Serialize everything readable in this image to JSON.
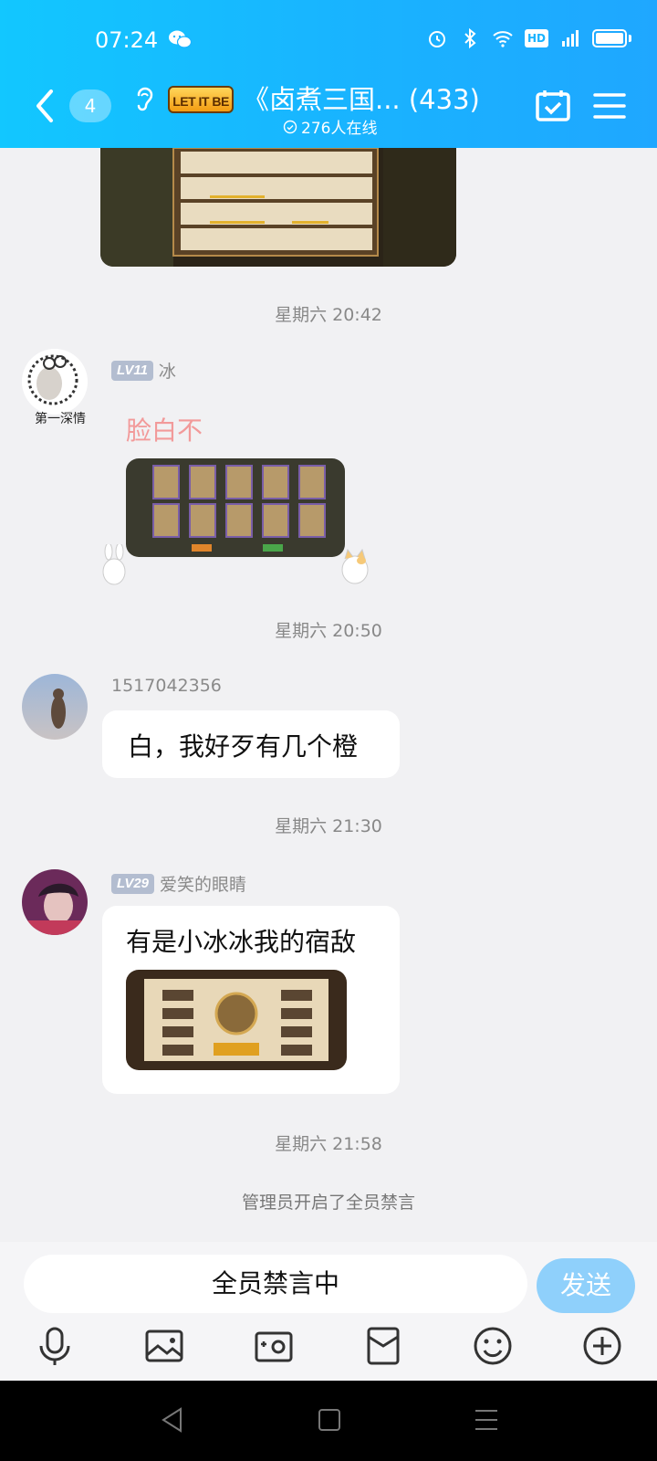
{
  "status_bar": {
    "time": "07:24",
    "hd": "HD",
    "network": "4G"
  },
  "header": {
    "unread_count": "4",
    "logo_text": "LET IT BE",
    "title": "《卤煮三国...  (433)",
    "online": "276人在线"
  },
  "messages": {
    "ts1": "星期六 20:42",
    "m1": {
      "level": "LV11",
      "name": "冰",
      "text": "脸白不",
      "avatar_caption": "第一深情"
    },
    "ts2": "星期六 20:50",
    "m2": {
      "name": "1517042356",
      "text": "白，我好歹有几个橙"
    },
    "ts3": "星期六 21:30",
    "m3": {
      "level": "LV29",
      "name": "爱笑的眼睛",
      "text": "有是小冰冰我的宿敌"
    },
    "ts4": "星期六 21:58",
    "system": "管理员开启了全员禁言"
  },
  "input": {
    "placeholder": "全员禁言中",
    "send_label": "发送"
  },
  "colors": {
    "header": "#19b3ff",
    "send": "#8fd0fb",
    "bg": "#f1f1f3"
  }
}
